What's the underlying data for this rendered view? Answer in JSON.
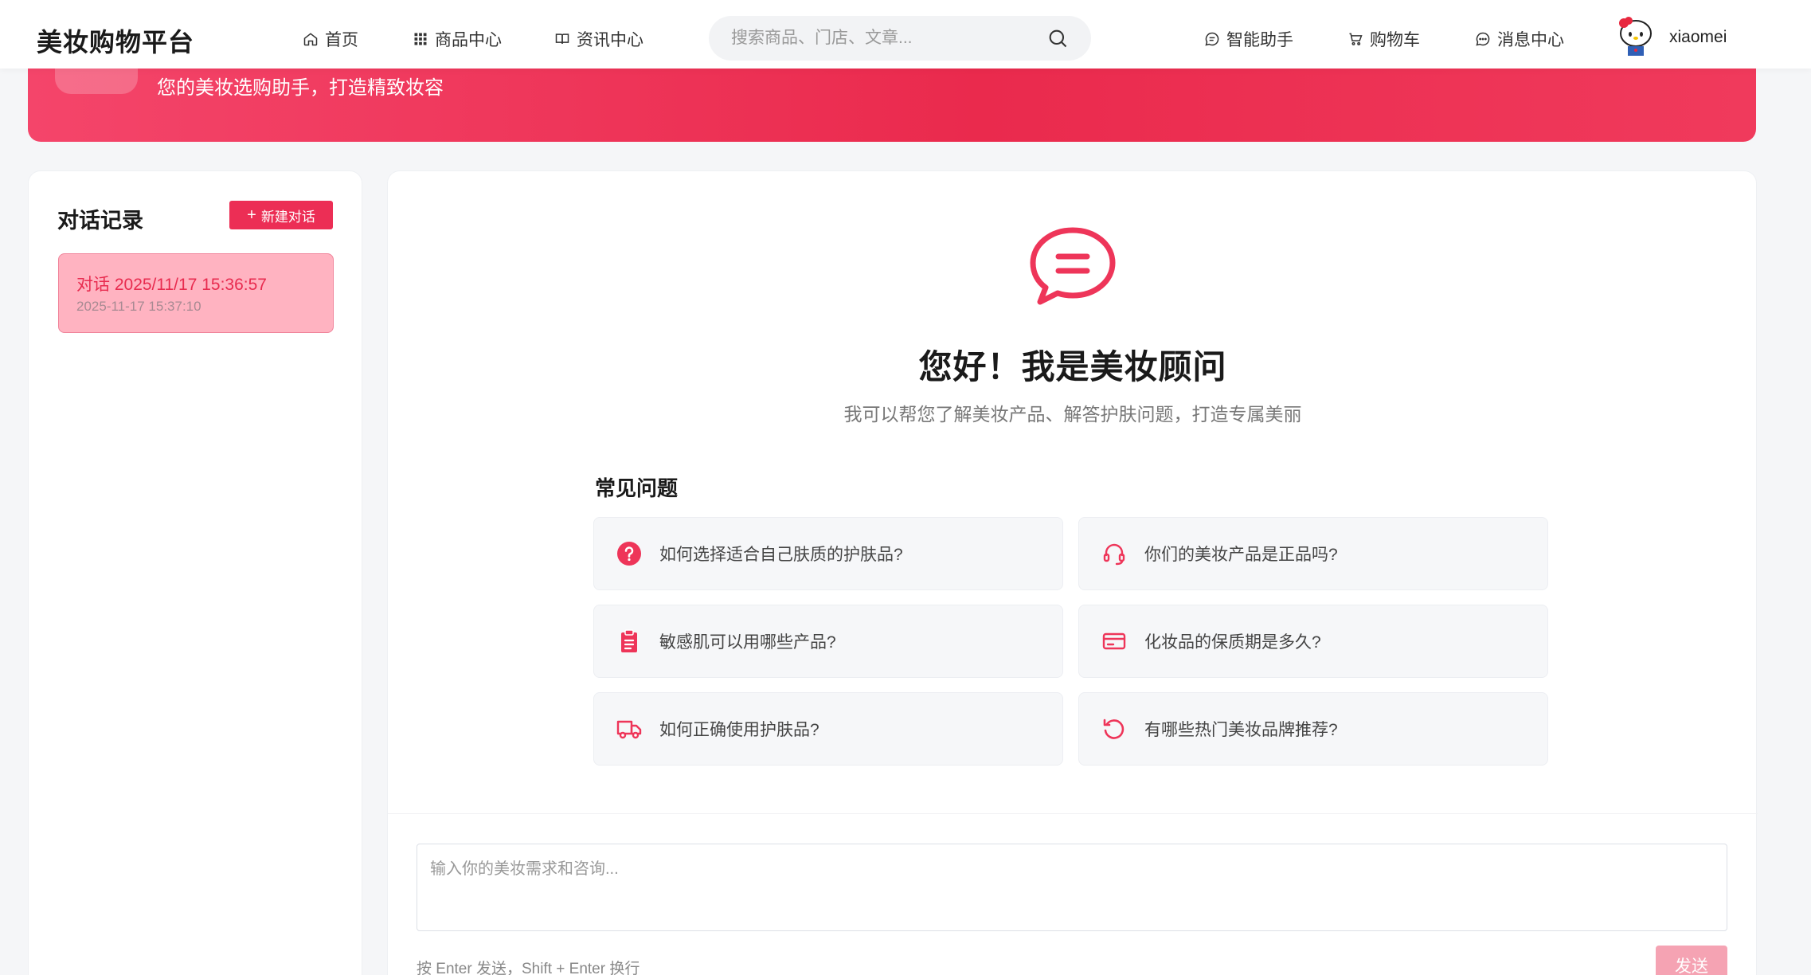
{
  "header": {
    "logo": "美妆购物平台",
    "nav": [
      {
        "label": "首页",
        "icon": "home-icon"
      },
      {
        "label": "商品中心",
        "icon": "grid-icon"
      },
      {
        "label": "资讯中心",
        "icon": "book-icon"
      }
    ],
    "search_placeholder": "搜索商品、门店、文章...",
    "right_nav": [
      {
        "label": "智能助手",
        "icon": "chat-icon"
      },
      {
        "label": "购物车",
        "icon": "cart-icon"
      },
      {
        "label": "消息中心",
        "icon": "message-icon"
      }
    ],
    "username": "xiaomei"
  },
  "banner": {
    "subtitle": "您的美妆选购助手，打造精致妆容"
  },
  "sidebar": {
    "title": "对话记录",
    "new_chat_label": "新建对话",
    "conversations": [
      {
        "title": "对话 2025/11/17 15:36:57",
        "time": "2025-11-17 15:37:10"
      }
    ]
  },
  "main": {
    "welcome_title": "您好！我是美妆顾问",
    "welcome_subtitle": "我可以帮您了解美妆产品、解答护肤问题，打造专属美丽",
    "faq_heading": "常见问题",
    "faqs": [
      {
        "text": "如何选择适合自己肤质的护肤品?",
        "icon": "question-icon"
      },
      {
        "text": "你们的美妆产品是正品吗?",
        "icon": "headset-icon"
      },
      {
        "text": "敏感肌可以用哪些产品?",
        "icon": "clipboard-icon"
      },
      {
        "text": "化妆品的保质期是多久?",
        "icon": "card-icon"
      },
      {
        "text": "如何正确使用护肤品?",
        "icon": "truck-icon"
      },
      {
        "text": "有哪些热门美妆品牌推荐?",
        "icon": "refresh-icon"
      }
    ],
    "input_placeholder": "输入你的美妆需求和咨询...",
    "hint": "按 Enter 发送，Shift + Enter 换行",
    "send_label": "发送"
  },
  "colors": {
    "accent": "#ec2e55",
    "accent_light": "#ffb3c1",
    "send_disabled": "#f5a3b3"
  }
}
